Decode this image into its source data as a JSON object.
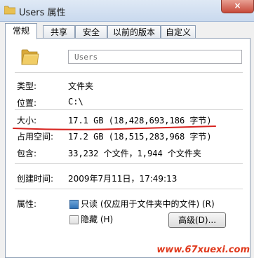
{
  "window": {
    "title": "Users 属性",
    "close_glyph": "×"
  },
  "tabs": [
    {
      "label": "常规",
      "active": true
    },
    {
      "label": "共享",
      "active": false
    },
    {
      "label": "安全",
      "active": false
    },
    {
      "label": "以前的版本",
      "active": false
    },
    {
      "label": "自定义",
      "active": false
    }
  ],
  "general": {
    "name_value": "Users",
    "rows": {
      "type": {
        "label": "类型:",
        "value": "文件夹"
      },
      "location": {
        "label": "位置:",
        "value": "C:\\"
      },
      "size": {
        "label": "大小:",
        "value": "17.1 GB (18,428,693,186 字节)"
      },
      "disk": {
        "label": "占用空间:",
        "value": "17.2 GB (18,515,283,968 字节)"
      },
      "contains": {
        "label": "包含:",
        "value": "33,232 个文件，1,944 个文件夹"
      },
      "created": {
        "label": "创建时间:",
        "value": "2009年7月11日，17:49:13"
      },
      "attributes": {
        "label": "属性:"
      }
    },
    "readonly_label": "只读 (仅应用于文件夹中的文件) (R)",
    "readonly_checked": true,
    "hidden_label": "隐藏 (H)",
    "hidden_checked": false,
    "advanced_label": "高级(D)..."
  },
  "watermark": "www.67xuexi.com",
  "colors": {
    "annotation_line": "#d8231f",
    "watermark": "#e03a1e",
    "folder": "#e8c052"
  }
}
